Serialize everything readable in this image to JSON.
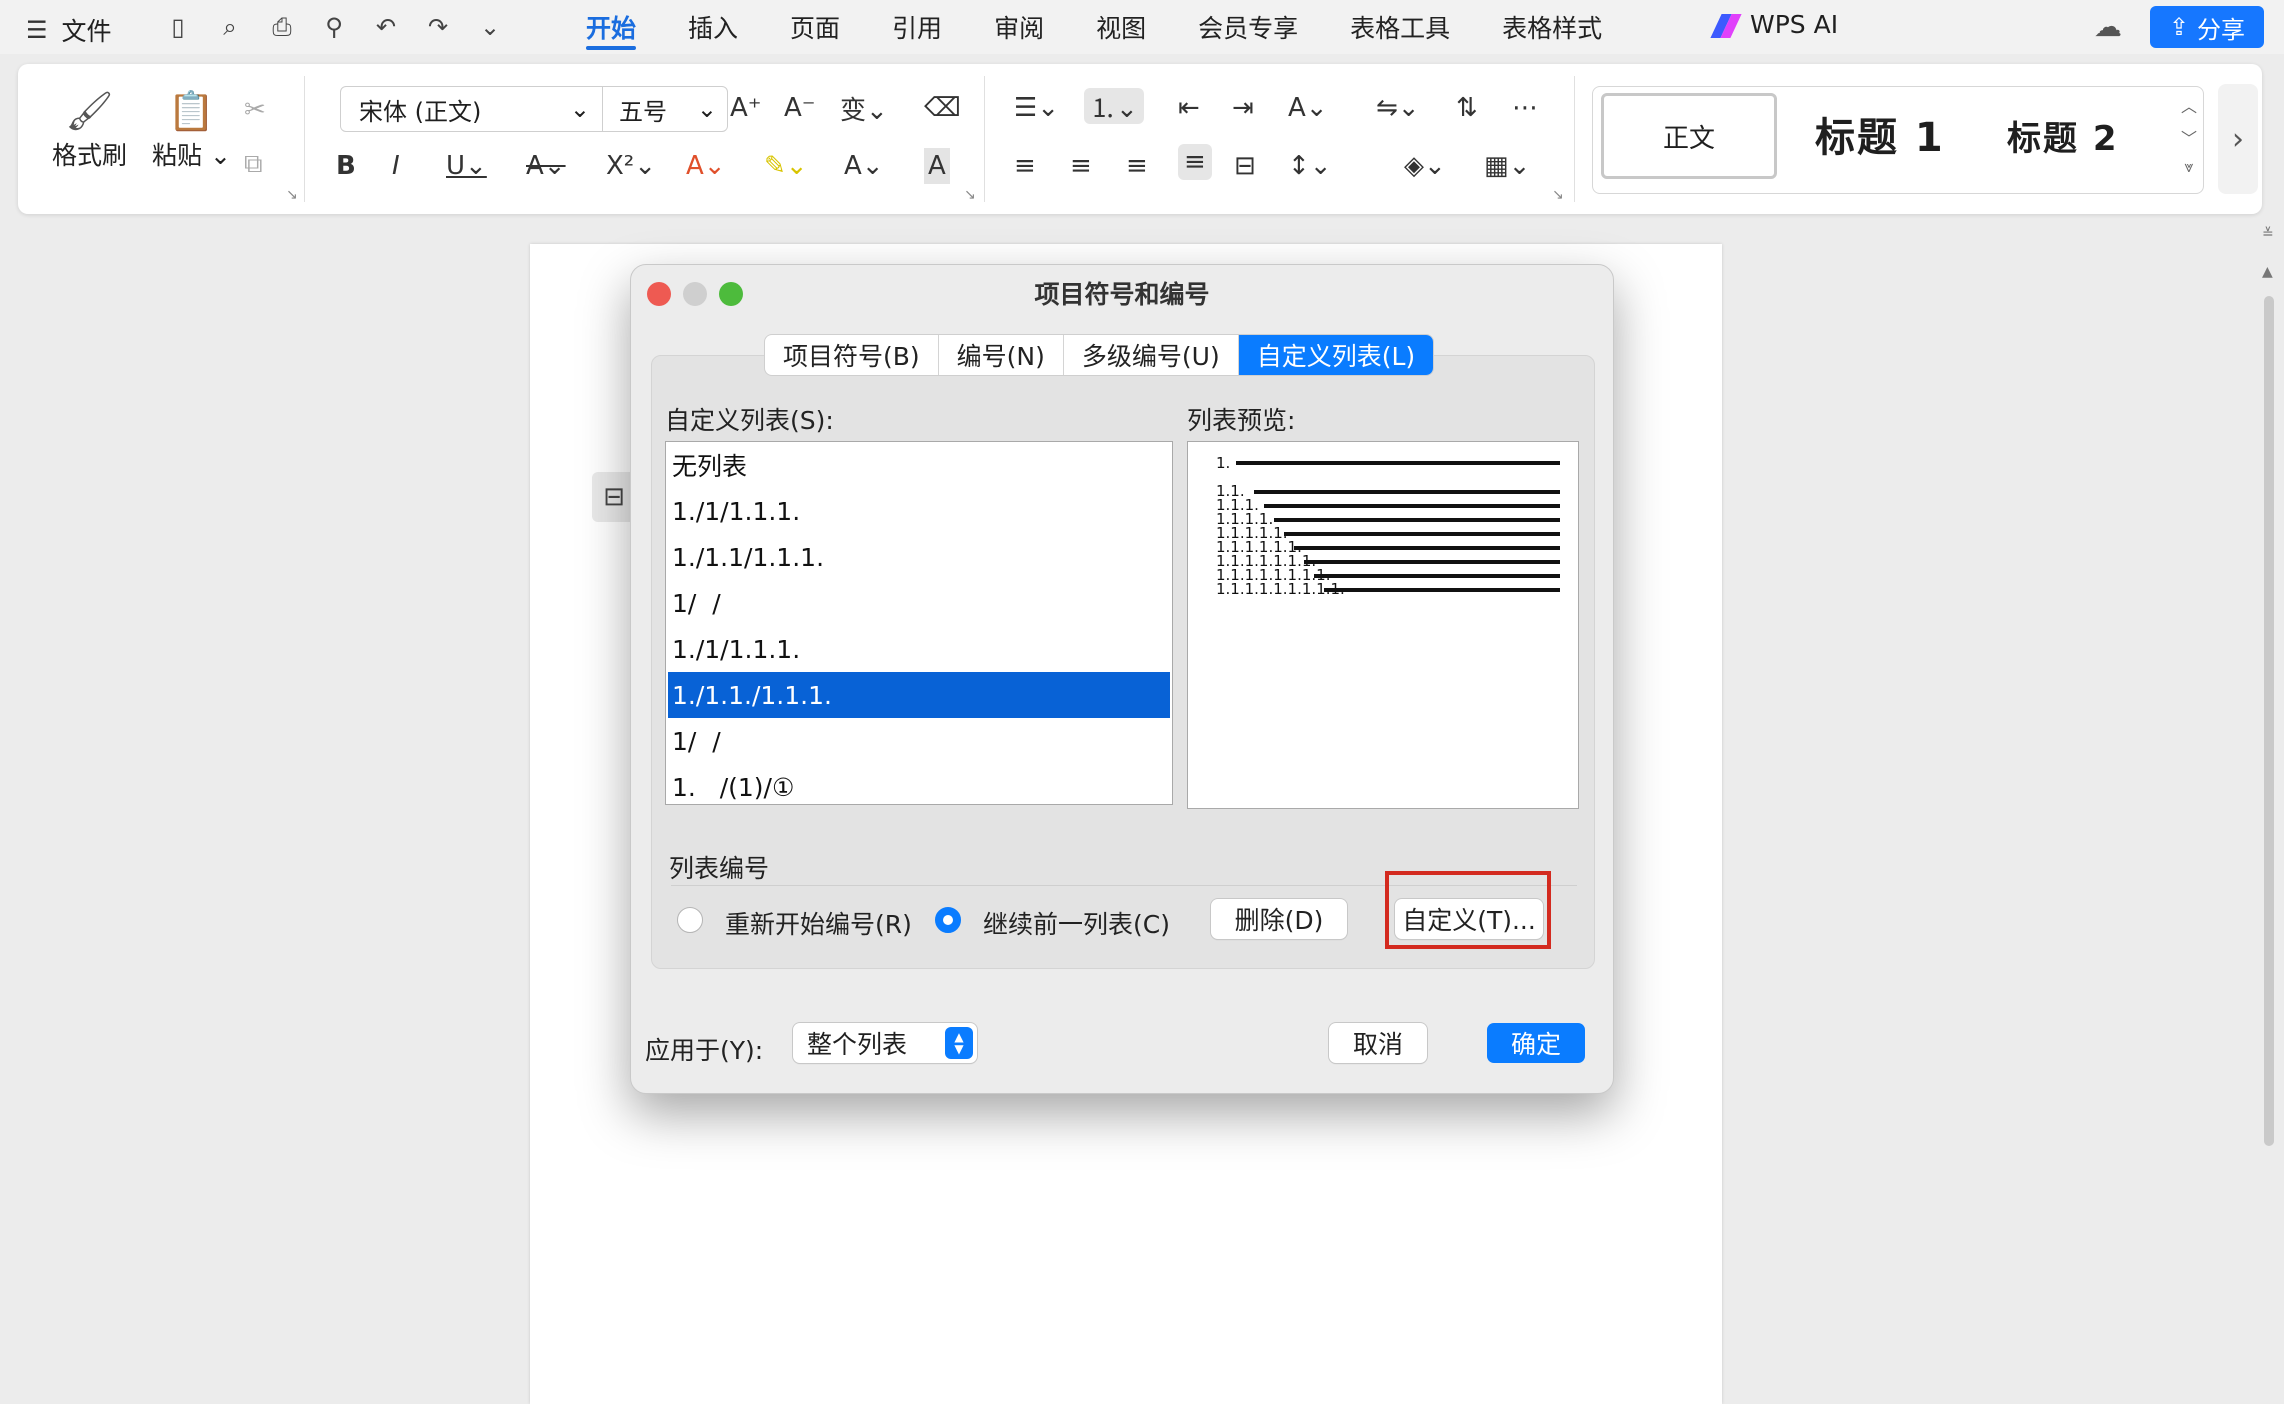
{
  "topbar": {
    "menu_label": "文件",
    "tabs": [
      "开始",
      "插入",
      "页面",
      "引用",
      "审阅",
      "视图",
      "会员专享",
      "表格工具",
      "表格样式"
    ],
    "active_tab": "开始",
    "wps_ai": "WPS AI",
    "share": "分享"
  },
  "ribbon": {
    "format_painter": "格式刷",
    "paste": "粘贴",
    "font_name": "宋体 (正文)",
    "font_size": "五号",
    "styles": {
      "normal": "正文",
      "heading1": "标题 1",
      "heading2": "标题 2"
    }
  },
  "dialog": {
    "title": "项目符号和编号",
    "tabs": [
      "项目符号(B)",
      "编号(N)",
      "多级编号(U)",
      "自定义列表(L)"
    ],
    "active_tab": "自定义列表(L)",
    "list_label": "自定义列表(S):",
    "preview_label": "列表预览:",
    "list_items": [
      "无列表",
      "1./1/1.1.1.",
      "1./1.1/1.1.1.",
      "1/  /",
      "1./1/1.1.1.",
      "1./1.1./1.1.1.",
      "1/  /",
      "1.   /(1)/①"
    ],
    "selected_index": 5,
    "preview_levels": [
      "1.",
      "1.1.",
      "1.1.1.",
      "1.1.1.1.",
      "1.1.1.1.1.",
      "1.1.1.1.1.1.",
      "1.1.1.1.1.1.1.",
      "1.1.1.1.1.1.1.1.",
      "1.1.1.1.1.1.1.1.1."
    ],
    "numbering_section": "列表编号",
    "restart_label": "重新开始编号(R)",
    "continue_label": "继续前一列表(C)",
    "continue_checked": true,
    "delete_button": "删除(D)",
    "customize_button": "自定义(T)...",
    "apply_label": "应用于(Y):",
    "apply_value": "整个列表",
    "cancel_button": "取消",
    "ok_button": "确定"
  },
  "colors": {
    "accent": "#0a7cff",
    "highlight": "#d32a1f",
    "selection": "#0862d6"
  }
}
